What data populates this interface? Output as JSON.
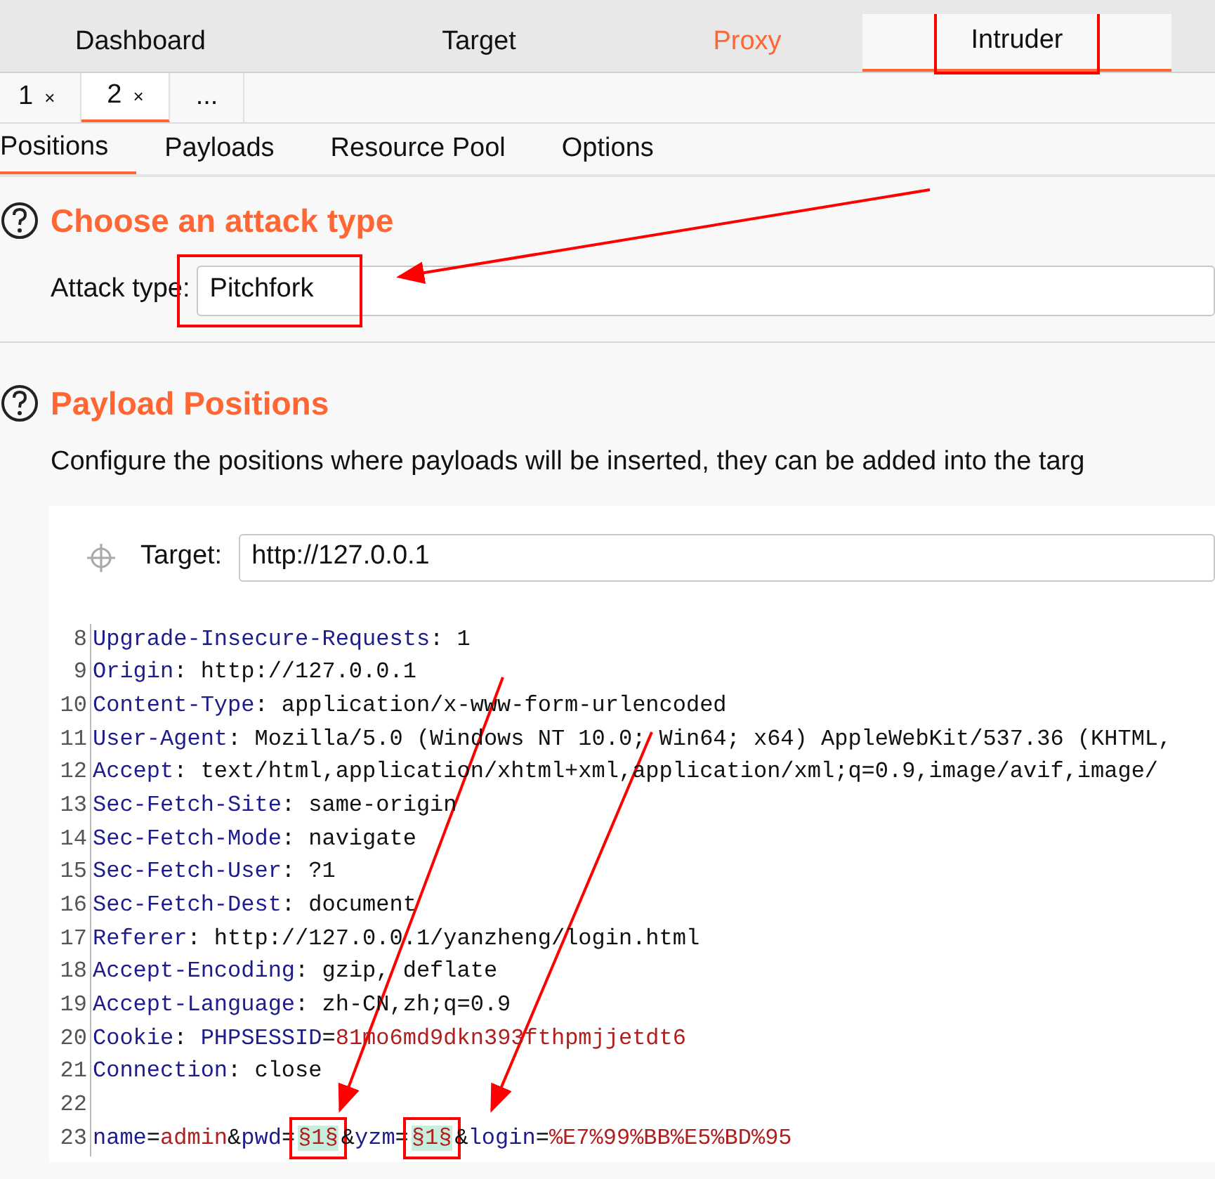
{
  "main_tabs": [
    {
      "label": "Dashboard",
      "selected": false,
      "highlighted": false,
      "annotated": false
    },
    {
      "label": "Target",
      "selected": false,
      "highlighted": false,
      "annotated": false
    },
    {
      "label": "Proxy",
      "selected": false,
      "highlighted": true,
      "annotated": false
    },
    {
      "label": "Intruder",
      "selected": true,
      "highlighted": false,
      "annotated": true
    }
  ],
  "attack_tabs": [
    {
      "label": "1",
      "close": "×",
      "selected": false
    },
    {
      "label": "2",
      "close": "×",
      "selected": true
    },
    {
      "label": "...",
      "selected": false
    }
  ],
  "sub_tabs": [
    {
      "label": "Positions",
      "selected": true
    },
    {
      "label": "Payloads",
      "selected": false
    },
    {
      "label": "Resource Pool",
      "selected": false
    },
    {
      "label": "Options",
      "selected": false
    }
  ],
  "attack_section": {
    "heading": "Choose an attack type",
    "label": "Attack type:",
    "value": "Pitchfork",
    "annotated": true
  },
  "positions_section": {
    "heading": "Payload Positions",
    "description": "Configure the positions where payloads will be inserted, they can be added into the targ",
    "target_label": "Target:",
    "target_value": "http://127.0.0.1"
  },
  "editor_lines": [
    {
      "number": "8",
      "segments": [
        {
          "kind": "key",
          "text": "Upgrade-Insecure-Requests"
        },
        {
          "kind": "plain",
          "text": ": 1"
        }
      ]
    },
    {
      "number": "9",
      "segments": [
        {
          "kind": "key",
          "text": "Origin"
        },
        {
          "kind": "plain",
          "text": ": http://127.0.0.1"
        }
      ]
    },
    {
      "number": "10",
      "segments": [
        {
          "kind": "key",
          "text": "Content-Type"
        },
        {
          "kind": "plain",
          "text": ": application/x-www-form-urlencoded"
        }
      ]
    },
    {
      "number": "11",
      "segments": [
        {
          "kind": "key",
          "text": "User-Agent"
        },
        {
          "kind": "plain",
          "text": ": Mozilla/5.0 (Windows NT 10.0; Win64; x64) AppleWebKit/537.36 (KHTML,"
        }
      ]
    },
    {
      "number": "12",
      "segments": [
        {
          "kind": "key",
          "text": "Accept"
        },
        {
          "kind": "plain",
          "text": ": text/html,application/xhtml+xml,application/xml;q=0.9,image/avif,image/"
        }
      ]
    },
    {
      "number": "13",
      "segments": [
        {
          "kind": "key",
          "text": "Sec-Fetch-Site"
        },
        {
          "kind": "plain",
          "text": ": same-origin"
        }
      ]
    },
    {
      "number": "14",
      "segments": [
        {
          "kind": "key",
          "text": "Sec-Fetch-Mode"
        },
        {
          "kind": "plain",
          "text": ": navigate"
        }
      ]
    },
    {
      "number": "15",
      "segments": [
        {
          "kind": "key",
          "text": "Sec-Fetch-User"
        },
        {
          "kind": "plain",
          "text": ": ?1"
        }
      ]
    },
    {
      "number": "16",
      "segments": [
        {
          "kind": "key",
          "text": "Sec-Fetch-Dest"
        },
        {
          "kind": "plain",
          "text": ": document"
        }
      ]
    },
    {
      "number": "17",
      "segments": [
        {
          "kind": "key",
          "text": "Referer"
        },
        {
          "kind": "plain",
          "text": ": http://127.0.0.1/yanzheng/login.html"
        }
      ]
    },
    {
      "number": "18",
      "segments": [
        {
          "kind": "key",
          "text": "Accept-Encoding"
        },
        {
          "kind": "plain",
          "text": ": gzip, deflate"
        }
      ]
    },
    {
      "number": "19",
      "segments": [
        {
          "kind": "key",
          "text": "Accept-Language"
        },
        {
          "kind": "plain",
          "text": ": zh-CN,zh;q=0.9"
        }
      ]
    },
    {
      "number": "20",
      "segments": [
        {
          "kind": "key",
          "text": "Cookie"
        },
        {
          "kind": "plain",
          "text": ": "
        },
        {
          "kind": "key",
          "text": "PHPSESSID"
        },
        {
          "kind": "plain",
          "text": "="
        },
        {
          "kind": "value",
          "text": "81mo6md9dkn393fthpmjjetdt6"
        }
      ]
    },
    {
      "number": "21",
      "segments": [
        {
          "kind": "key",
          "text": "Connection"
        },
        {
          "kind": "plain",
          "text": ": close"
        }
      ]
    },
    {
      "number": "22"
    },
    {
      "number": "23",
      "segments": [
        {
          "kind": "key",
          "text": "name"
        },
        {
          "kind": "plain",
          "text": "="
        },
        {
          "kind": "value",
          "text": "admin"
        },
        {
          "kind": "plain",
          "text": "&"
        },
        {
          "kind": "key",
          "text": "pwd"
        },
        {
          "kind": "plain",
          "text": "="
        },
        {
          "kind": "payload",
          "text": "§1§",
          "annotated": true
        },
        {
          "kind": "plain",
          "text": "&"
        },
        {
          "kind": "key",
          "text": "yzm"
        },
        {
          "kind": "plain",
          "text": "="
        },
        {
          "kind": "payload",
          "text": "§1§",
          "annotated": true
        },
        {
          "kind": "plain",
          "text": "&"
        },
        {
          "kind": "key",
          "text": "login"
        },
        {
          "kind": "plain",
          "text": "="
        },
        {
          "kind": "value",
          "text": "%E7%99%BB%E5%BD%95"
        }
      ]
    }
  ]
}
